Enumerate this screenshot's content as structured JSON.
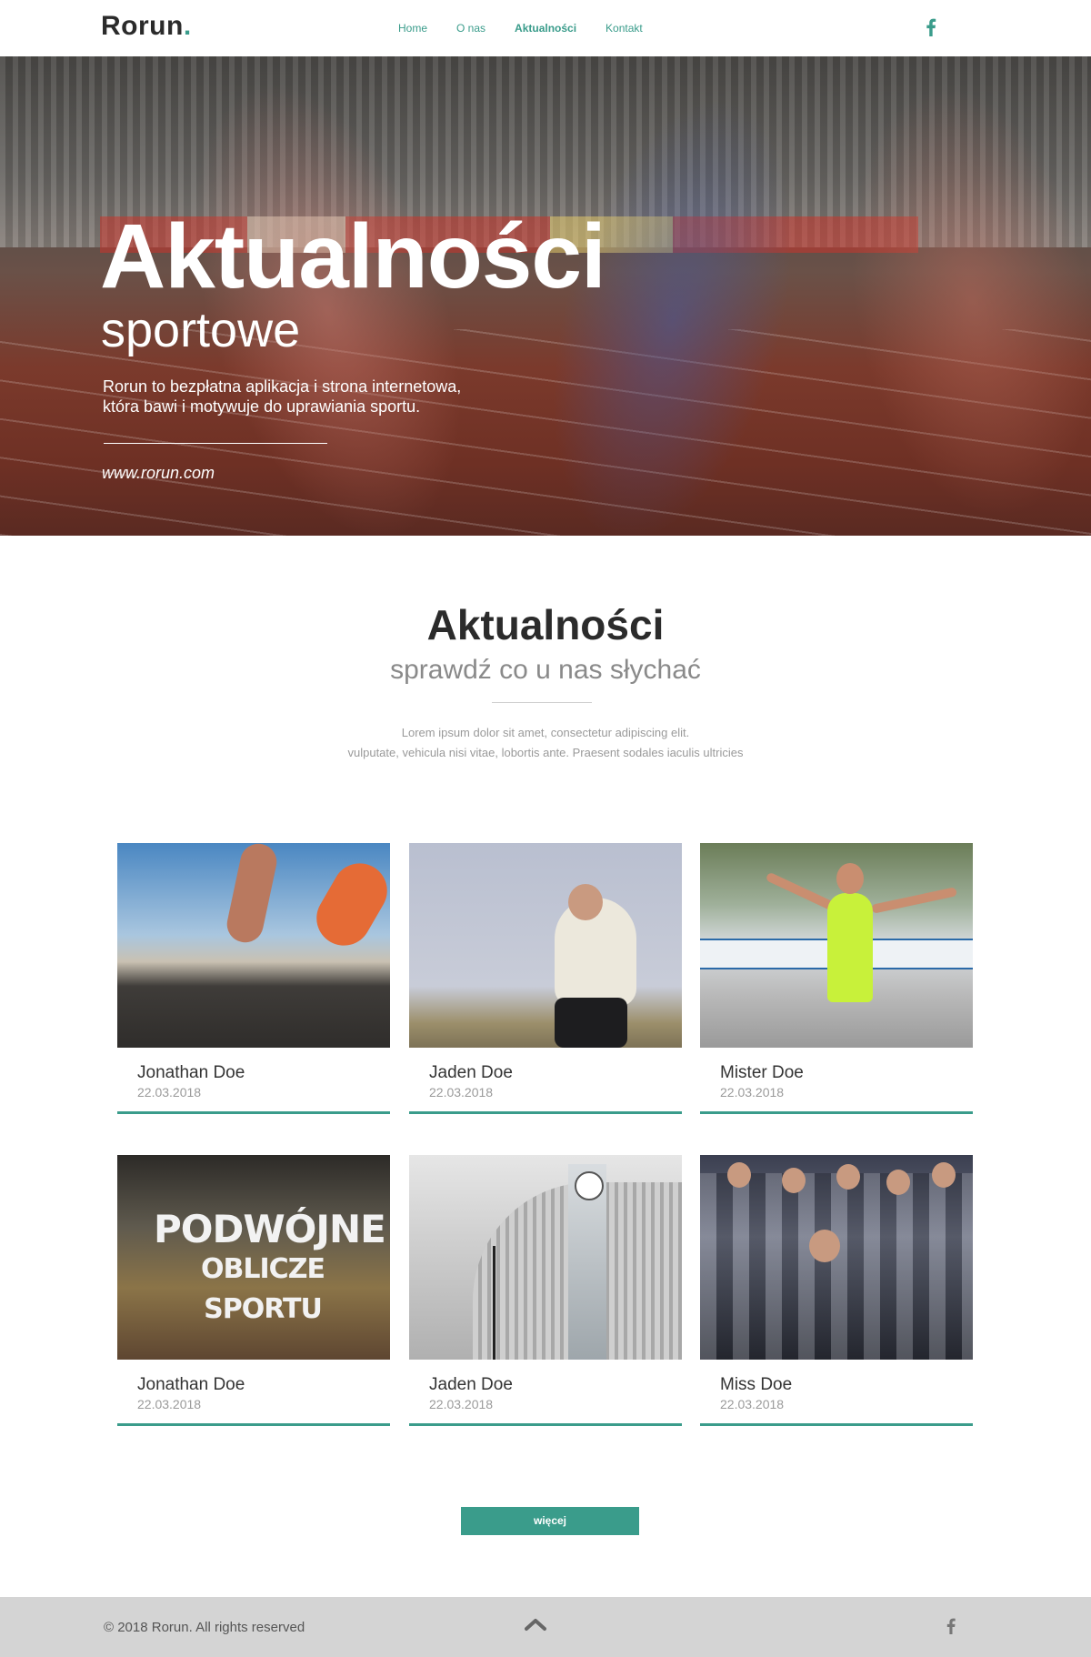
{
  "brand": {
    "name": "Rorun",
    "dot": "."
  },
  "nav": {
    "items": [
      "Home",
      "O nas",
      "Aktualności",
      "Kontakt"
    ],
    "active": "Aktualności"
  },
  "icons": {
    "social_top": "facebook-icon",
    "scroll_up": "chevron-up-icon",
    "social_bottom": "facebook-icon"
  },
  "hero": {
    "title": "Aktualności",
    "subtitle": "sportowe",
    "description_line1": "Rorun to bezpłatna aplikacja i strona internetowa,",
    "description_line2": "która bawi i motywuje do uprawiania sportu.",
    "url": "www.rorun.com"
  },
  "news": {
    "title": "Aktualności",
    "subtitle": "sprawdź co u nas słychać",
    "desc_line1": "Lorem ipsum dolor sit amet, consectetur adipiscing elit.",
    "desc_line2": "vulputate, vehicula nisi vitae, lobortis ante. Praesent sodales iaculis ultricies"
  },
  "cards": [
    {
      "name": "Jonathan Doe",
      "date": "22.03.2018"
    },
    {
      "name": "Jaden Doe",
      "date": "22.03.2018"
    },
    {
      "name": "Mister Doe",
      "date": "22.03.2018"
    },
    {
      "name": "Jonathan Doe",
      "date": "22.03.2018"
    },
    {
      "name": "Jaden Doe",
      "date": "22.03.2018"
    },
    {
      "name": "Miss Doe",
      "date": "22.03.2018"
    }
  ],
  "poster": {
    "line1": "PODWÓJNE",
    "line2": "OBLICZE SPORTU"
  },
  "more_button": "więcej",
  "footer": {
    "copyright": "© 2018 Rorun. All rights reserved"
  },
  "colors": {
    "accent": "#3a9c8b",
    "footer_bg": "#d4d4d4",
    "heading": "#2b2b2b"
  }
}
